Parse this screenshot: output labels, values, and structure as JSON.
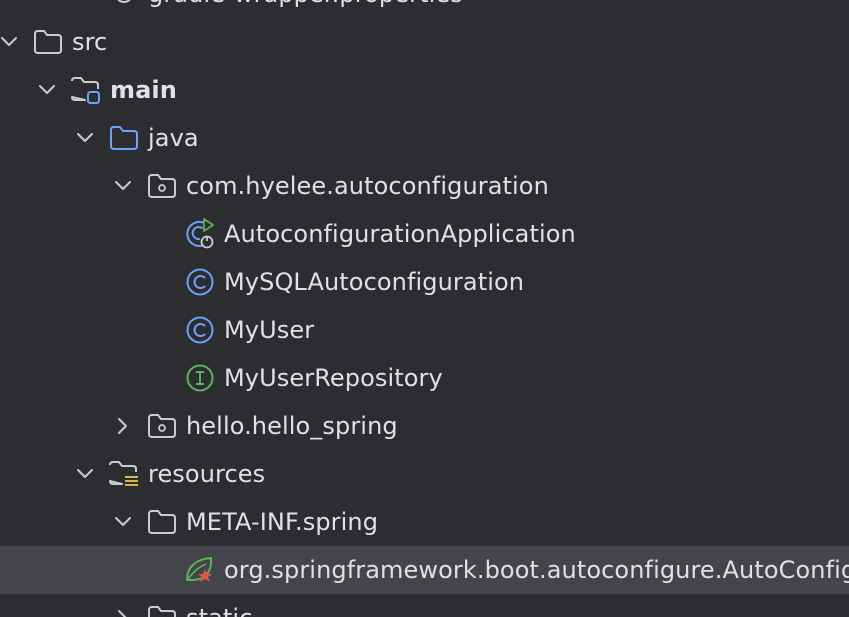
{
  "tree": {
    "rows": [
      {
        "label": "gradle-wrapper.properties",
        "depth": 2,
        "chevron": "none",
        "icon": "gear-icon"
      },
      {
        "label": "src",
        "depth": 0,
        "chevron": "down",
        "icon": "folder-icon"
      },
      {
        "label": "main",
        "depth": 1,
        "chevron": "down",
        "icon": "source-root-folder-icon",
        "bold": true
      },
      {
        "label": "java",
        "depth": 2,
        "chevron": "down",
        "icon": "java-folder-icon"
      },
      {
        "label": "com.hyelee.autoconfiguration",
        "depth": 3,
        "chevron": "down",
        "icon": "package-icon"
      },
      {
        "label": "AutoconfigurationApplication",
        "depth": 4,
        "chevron": "none",
        "icon": "spring-boot-application-class-icon"
      },
      {
        "label": "MySQLAutoconfiguration",
        "depth": 4,
        "chevron": "none",
        "icon": "class-icon"
      },
      {
        "label": "MyUser",
        "depth": 4,
        "chevron": "none",
        "icon": "class-icon"
      },
      {
        "label": "MyUserRepository",
        "depth": 4,
        "chevron": "none",
        "icon": "interface-icon"
      },
      {
        "label": "hello.hello_spring",
        "depth": 3,
        "chevron": "right",
        "icon": "package-icon"
      },
      {
        "label": "resources",
        "depth": 2,
        "chevron": "down",
        "icon": "resources-folder-icon"
      },
      {
        "label": "META-INF.spring",
        "depth": 3,
        "chevron": "down",
        "icon": "folder-icon"
      },
      {
        "label": "org.springframework.boot.autoconfigure.AutoConfiguration.imports",
        "depth": 4,
        "chevron": "none",
        "icon": "spring-imports-file-icon",
        "selected": true
      },
      {
        "label": "static",
        "depth": 3,
        "chevron": "right",
        "icon": "folder-icon"
      }
    ]
  },
  "colors": {
    "background": "#2b2d30",
    "selected_row": "#43454a",
    "text": "#dfe1e5",
    "chevron": "#c9ccd1",
    "folder_outline": "#c9ccd1",
    "java_folder": "#6fa0f5",
    "class_icon": "#6fa0f5",
    "interface_icon": "#5fb05a",
    "spring_green": "#5fb05a",
    "spring_red": "#e0554b",
    "resources_lines": "#d7b64a"
  }
}
